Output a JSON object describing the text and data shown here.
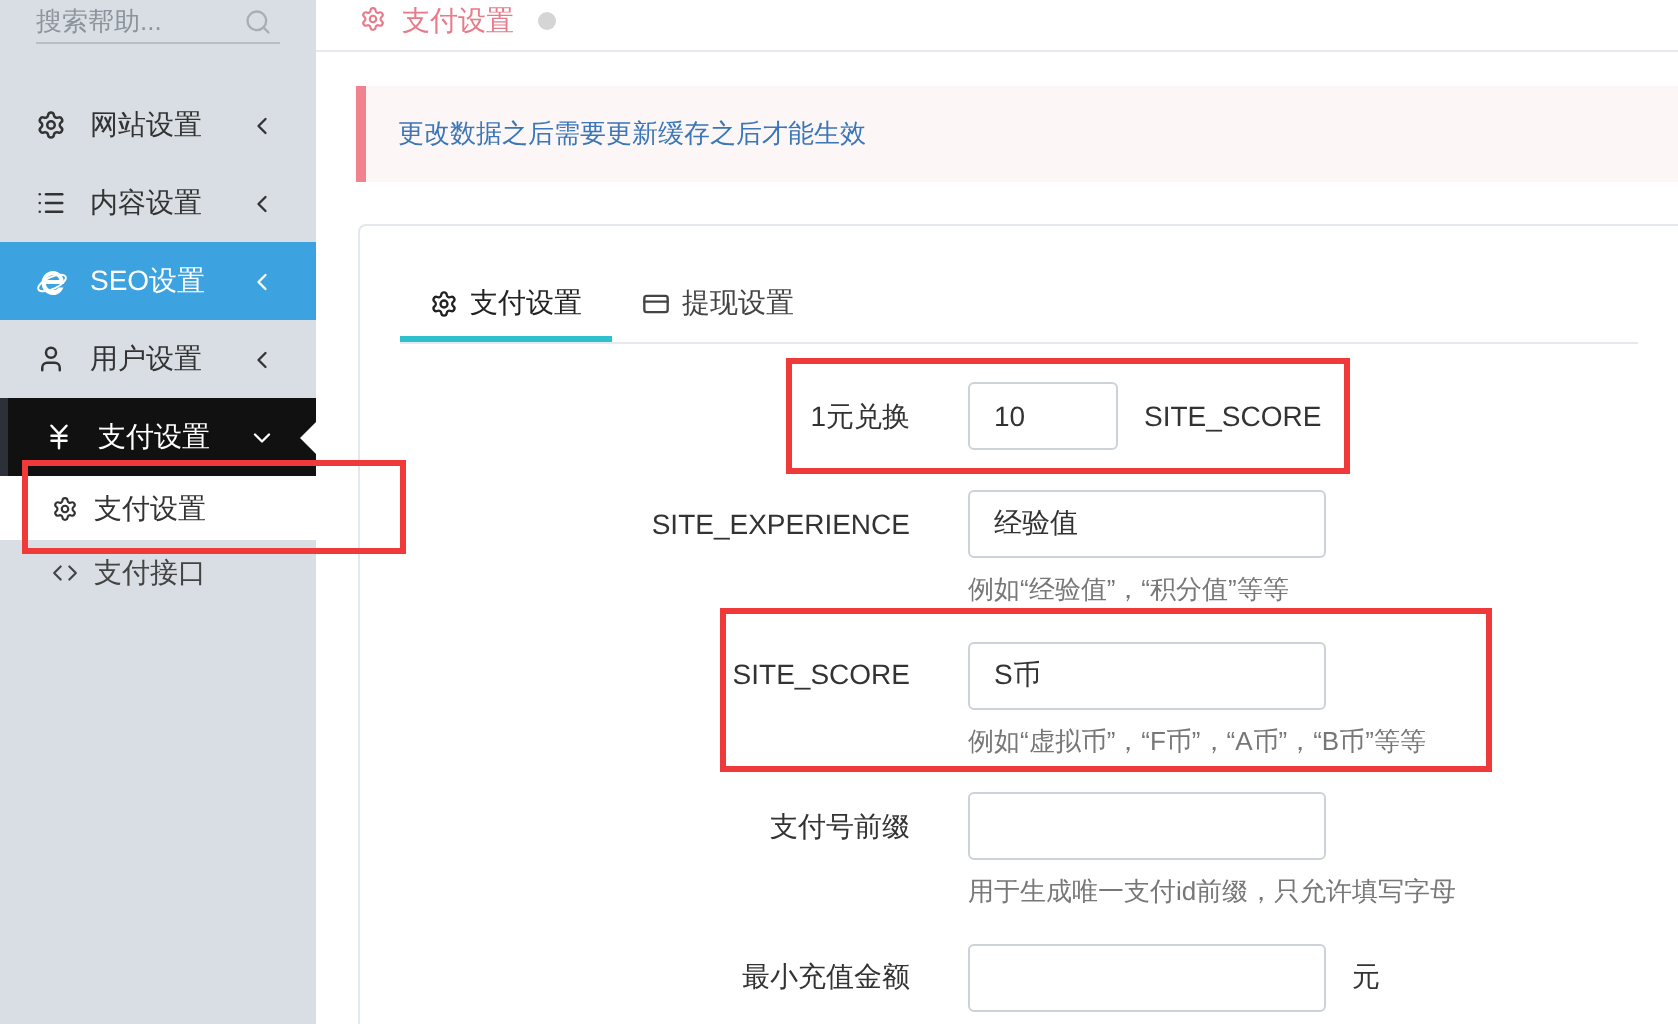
{
  "sidebar": {
    "search": {
      "placeholder": "搜索帮助..."
    },
    "items": [
      {
        "label": "网站设置",
        "selected": false,
        "expanded": false
      },
      {
        "label": "内容设置",
        "selected": false,
        "expanded": false
      },
      {
        "label": "SEO设置",
        "selected": false,
        "expanded": false,
        "hover": true
      },
      {
        "label": "用户设置",
        "selected": false,
        "expanded": false
      },
      {
        "label": "支付设置",
        "selected": true,
        "expanded": true,
        "children": [
          {
            "label": "支付设置",
            "selected": true
          },
          {
            "label": "支付接口",
            "selected": false
          }
        ]
      }
    ]
  },
  "breadcrumb": {
    "label": "支付设置"
  },
  "alert": "更改数据之后需要更新缓存之后才能生效",
  "tabs": [
    {
      "label": "支付设置",
      "selected": true
    },
    {
      "label": "提现设置",
      "selected": false
    }
  ],
  "form": [
    {
      "label": "1元兑换",
      "value": "10",
      "suffix": "SITE_SCORE"
    },
    {
      "label": "SITE_EXPERIENCE",
      "value": "经验值",
      "help": "例如“经验值”，“积分值”等等"
    },
    {
      "label": "SITE_SCORE",
      "value": "S币",
      "help": "例如“虚拟币”，“F币”，“A币”，“B币”等等"
    },
    {
      "label": "支付号前缀",
      "help": "用于生成唯一支付id前缀，只允许填写字母"
    },
    {
      "label": "最小充值金额",
      "suffix": "元"
    }
  ]
}
